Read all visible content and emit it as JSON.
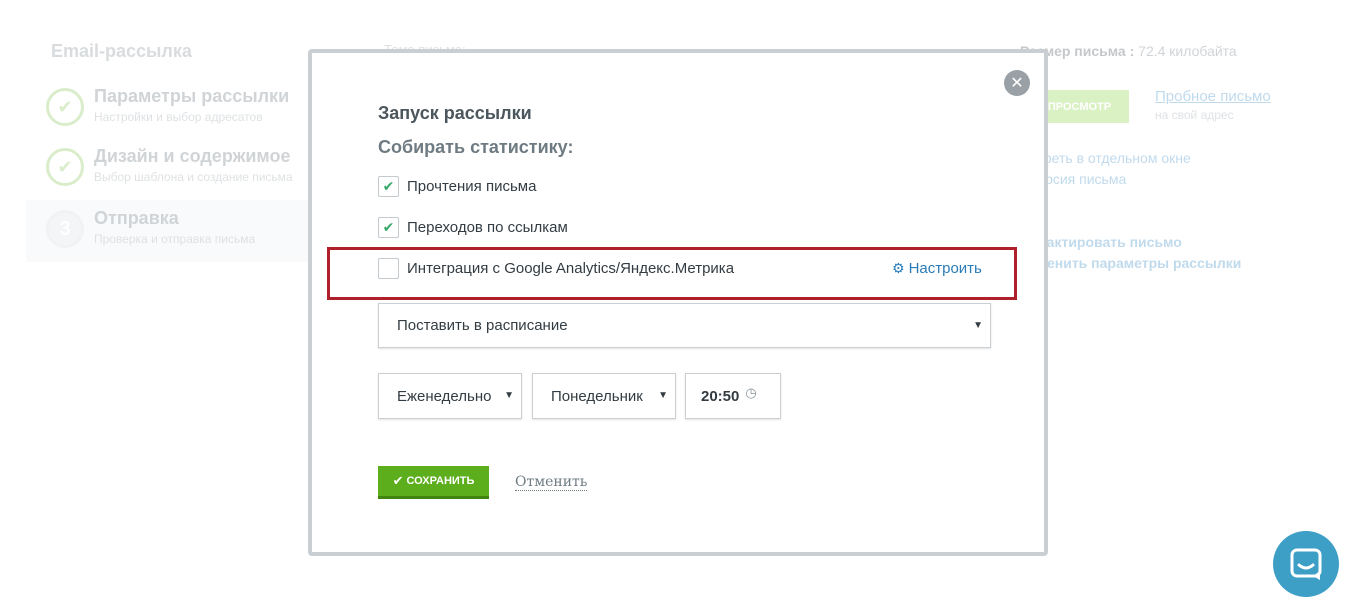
{
  "background": {
    "section_title": "Email-рассылка",
    "steps": [
      {
        "number": "✔",
        "title": "Параметры рассылки",
        "subtitle": "Настройки и выбор адресатов"
      },
      {
        "number": "✔",
        "title": "Дизайн и содержимое",
        "subtitle": "Выбор шаблона и создание письма"
      },
      {
        "number": "3",
        "title": "Отправка",
        "subtitle": "Проверка и отправка письма"
      }
    ],
    "topic_label": "Тема письма:",
    "size_label": "Размер письма :",
    "size_value": "72.4 килобайта",
    "preview_button": "ПРОСМОТР",
    "test_email_link": "Пробное письмо",
    "test_email_sub": "на свой адрес",
    "view_window_line1": "отреть в отдельном окне",
    "view_window_line2": "версия письма",
    "edit_letter": "едактировать письмо",
    "edit_params": "зменить параметры рассылки"
  },
  "modal": {
    "title": "Запуск рассылки",
    "stats_heading": "Собирать статистику:",
    "checkboxes": [
      {
        "label": "Прочтения письма",
        "checked": true
      },
      {
        "label": "Переходов по ссылкам",
        "checked": true
      },
      {
        "label": "Интеграция с Google Analytics/Яндекс.Метрика",
        "checked": false
      }
    ],
    "configure_link": "Настроить",
    "schedule_select": "Поставить в расписание",
    "frequency_select": "Еженедельно",
    "day_select": "Понедельник",
    "time_value": "20:50",
    "save_button": "СОХРАНИТЬ",
    "cancel_link": "Отменить"
  },
  "colors": {
    "highlight": "#b0202a",
    "save": "#5cae1d",
    "chat": "#3d9fc6"
  }
}
